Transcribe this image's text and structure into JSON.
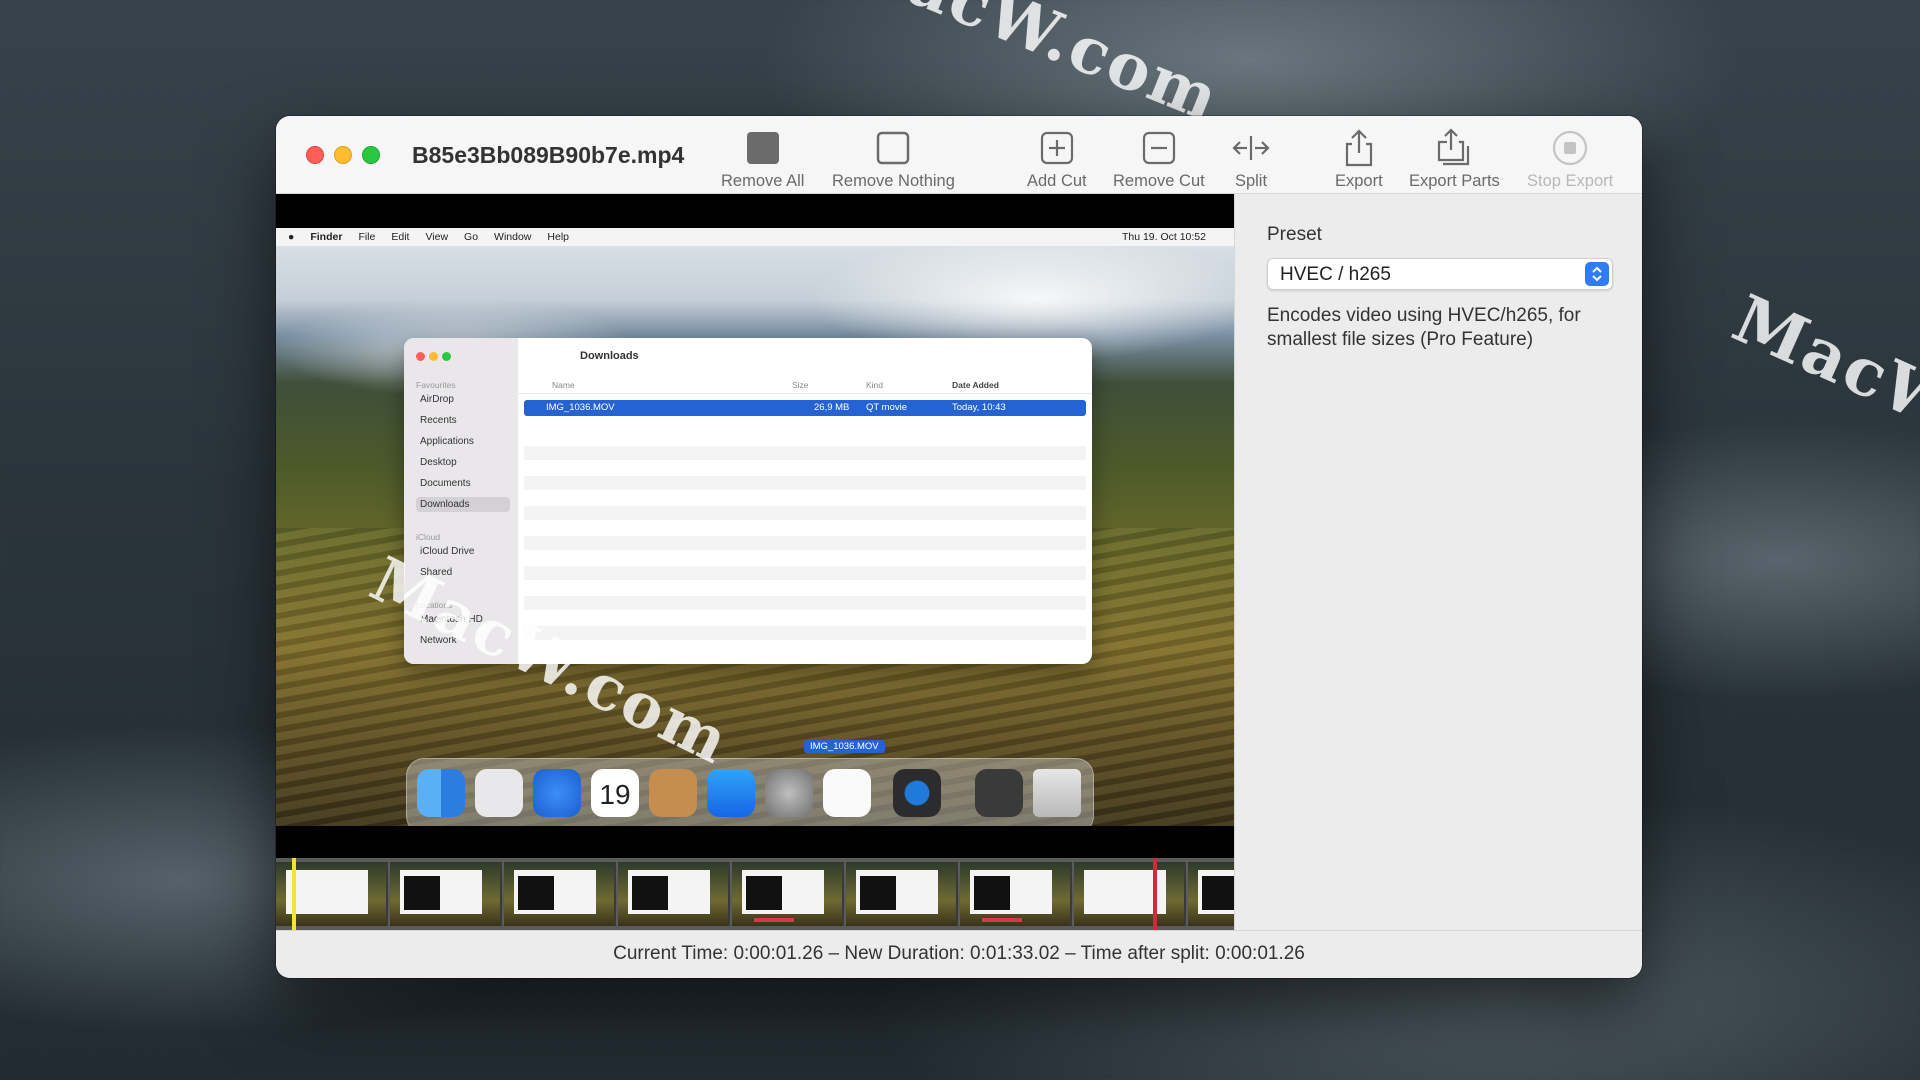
{
  "window": {
    "title": "B85e3Bb089B90b7e.mp4"
  },
  "toolbar": {
    "remove_all": "Remove All",
    "remove_nothing": "Remove Nothing",
    "add_cut": "Add Cut",
    "remove_cut": "Remove Cut",
    "split": "Split",
    "export": "Export",
    "export_parts": "Export Parts",
    "stop_export": "Stop Export"
  },
  "preview": {
    "menubar": {
      "items": [
        "Finder",
        "File",
        "Edit",
        "View",
        "Go",
        "Window",
        "Help"
      ],
      "clock": "Thu 19. Oct 10:52"
    },
    "finder": {
      "title": "Downloads",
      "sidebar": {
        "favourites_label": "Favourites",
        "favourites": [
          "AirDrop",
          "Recents",
          "Applications",
          "Desktop",
          "Documents",
          "Downloads"
        ],
        "icloud_label": "iCloud",
        "icloud": [
          "iCloud Drive",
          "Shared"
        ],
        "locations_label": "Locations",
        "locations": [
          "Macintosh HD",
          "Network"
        ]
      },
      "columns": [
        "Name",
        "Size",
        "Kind",
        "Date Added"
      ],
      "file": {
        "name": "IMG_1036.MOV",
        "size": "26,9 MB",
        "kind": "QT movie",
        "date": "Today, 10:43"
      }
    },
    "drag_label": "IMG_1036.MOV",
    "dock_calendar_day": "19"
  },
  "sidebar": {
    "preset_label": "Preset",
    "preset_value": "HVEC / h265",
    "description": "Encodes video using HVEC/h265, for smallest file sizes (Pro Feature)"
  },
  "status": {
    "text": "Current Time: 0:00:01.26 – New Duration: 0:01:33.02 – Time after split: 0:00:01.26"
  },
  "colors": {
    "accent": "#2f7cf6",
    "selection": "#2463d1",
    "playhead_current": "#f2e23a",
    "playhead_split": "#d8263d"
  },
  "watermark": "MacW.com"
}
